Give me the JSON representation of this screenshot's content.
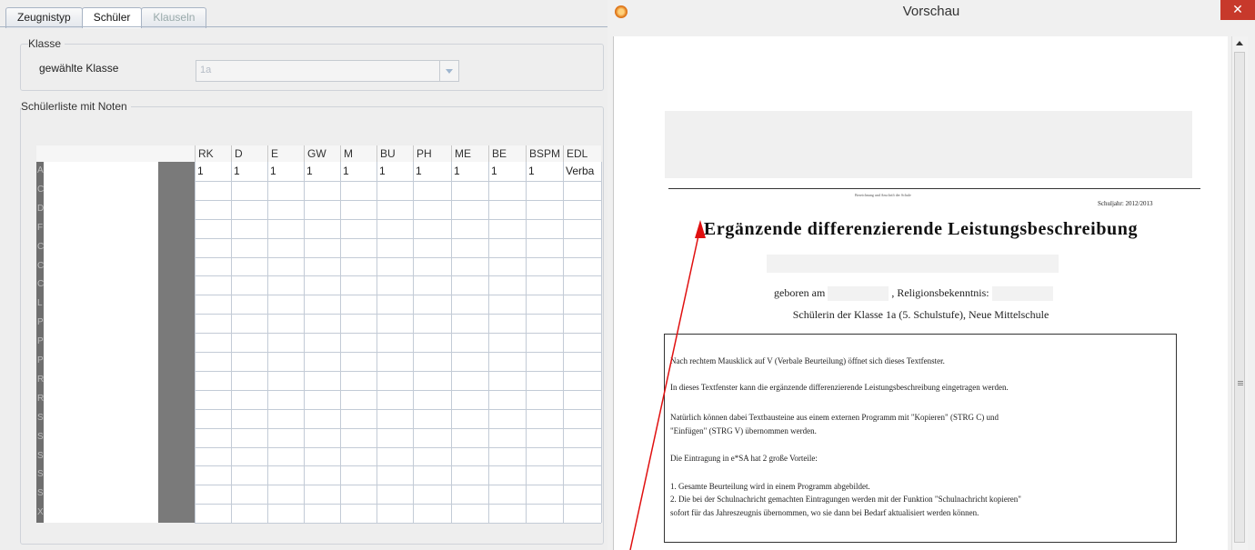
{
  "left_app": {
    "tabs": [
      {
        "label": "Zeugnistyp"
      },
      {
        "label": "Schüler"
      },
      {
        "label": "Klauseln"
      }
    ],
    "klasse_group_title": "Klasse",
    "klasse_label": "gewählte Klasse",
    "klasse_value": "1a",
    "schuelerliste_title": "Schülerliste mit Noten",
    "columns": [
      "RK",
      "D",
      "E",
      "GW",
      "M",
      "BU",
      "PH",
      "ME",
      "BE",
      "BSPM",
      "EDL"
    ],
    "first_row_values": [
      "1",
      "1",
      "1",
      "1",
      "1",
      "1",
      "1",
      "1",
      "1",
      "1",
      "Verba"
    ],
    "row_initials": [
      "A",
      "C",
      "D",
      "F",
      "C",
      "C",
      "C",
      "L",
      "P",
      "P",
      "P",
      "R",
      "R",
      "S",
      "S",
      "S",
      "S",
      "S",
      "X"
    ]
  },
  "preview_window": {
    "title": "Vorschau",
    "close_label": "✕",
    "document": {
      "tiny_header": "Bezeichnung und Anschrift der Schule",
      "schuljahr": "Schuljahr: 2012/2013",
      "title": "Ergänzende differenzierende Leistungsbeschreibung",
      "geboren_label": "geboren am",
      "religion_label": ", Religionsbekenntnis:",
      "class_line": "Schülerin der Klasse 1a (5. Schulstufe), Neue Mittelschule",
      "lines": [
        "Nach rechtem Mausklick auf V (Verbale Beurteilung) öffnet sich dieses Textfenster.",
        "In dieses Textfenster kann die ergänzende differenzierende Leistungsbeschreibung eingetragen werden.",
        "Natürlich können dabei Textbausteine aus einem externen Programm mit \"Kopieren\" (STRG C) und",
        "\"Einfügen\" (STRG V) übernommen werden.",
        "Die Eintragung in e*SA hat 2 große Vorteile:",
        "1. Gesamte Beurteilung wird in einem Programm abgebildet.",
        "2. Die bei der Schulnachricht gemachten Eintragungen werden mit der Funktion \"Schulnachricht kopieren\"",
        "    sofort für das Jahreszeugnis übernommen, wo sie dann bei Bedarf aktualisiert werden können."
      ]
    }
  },
  "colors": {
    "close_red": "#c7392b",
    "arrow_red": "#e01010",
    "row_header_gray": "#7a7a7a"
  }
}
